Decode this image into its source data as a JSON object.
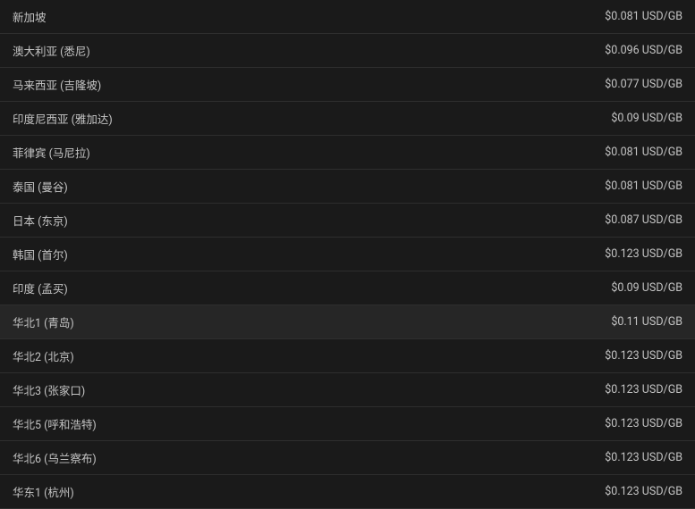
{
  "rows": [
    {
      "region": "新加坡",
      "price": "$0.081 USD/GB",
      "highlighted": false
    },
    {
      "region": "澳大利亚 (悉尼)",
      "price": "$0.096 USD/GB",
      "highlighted": false
    },
    {
      "region": "马来西亚 (吉隆坡)",
      "price": "$0.077 USD/GB",
      "highlighted": false
    },
    {
      "region": "印度尼西亚 (雅加达)",
      "price": "$0.09 USD/GB",
      "highlighted": false
    },
    {
      "region": "菲律宾 (马尼拉)",
      "price": "$0.081 USD/GB",
      "highlighted": false
    },
    {
      "region": "泰国 (曼谷)",
      "price": "$0.081 USD/GB",
      "highlighted": false
    },
    {
      "region": "日本 (东京)",
      "price": "$0.087 USD/GB",
      "highlighted": false
    },
    {
      "region": "韩国 (首尔)",
      "price": "$0.123 USD/GB",
      "highlighted": false
    },
    {
      "region": "印度 (孟买)",
      "price": "$0.09 USD/GB",
      "highlighted": false
    },
    {
      "region": "华北1 (青岛)",
      "price": "$0.11 USD/GB",
      "highlighted": true
    },
    {
      "region": "华北2 (北京)",
      "price": "$0.123 USD/GB",
      "highlighted": false
    },
    {
      "region": "华北3 (张家口)",
      "price": "$0.123 USD/GB",
      "highlighted": false
    },
    {
      "region": "华北5 (呼和浩特)",
      "price": "$0.123 USD/GB",
      "highlighted": false
    },
    {
      "region": "华北6 (乌兰察布)",
      "price": "$0.123 USD/GB",
      "highlighted": false
    },
    {
      "region": "华东1 (杭州)",
      "price": "$0.123 USD/GB",
      "highlighted": false
    }
  ]
}
